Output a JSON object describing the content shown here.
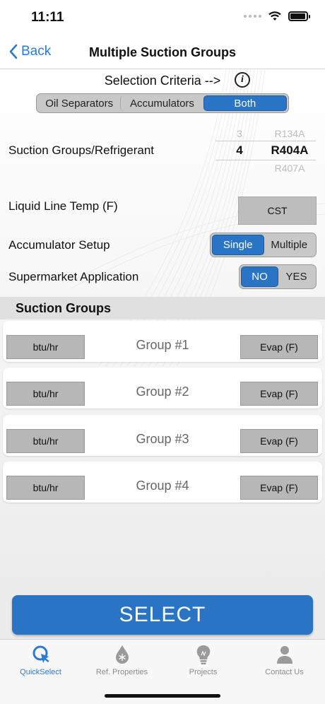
{
  "status": {
    "time": "11:11"
  },
  "nav": {
    "back_label": "Back",
    "title": "Multiple Suction Groups"
  },
  "criteria": {
    "label": "Selection Criteria -->",
    "options": [
      "Oil Separators",
      "Accumulators",
      "Both"
    ],
    "selected": "Both"
  },
  "suction": {
    "label": "Suction Groups/Refrigerant",
    "picker": {
      "prev": [
        "3",
        "R134A"
      ],
      "selected": [
        "4",
        "R404A"
      ],
      "next": [
        "",
        "R407A"
      ]
    }
  },
  "liquid_line": {
    "label": "Liquid Line Temp (F)",
    "button": "CST"
  },
  "accumulator": {
    "label": "Accumulator Setup",
    "options": [
      "Single",
      "Multiple"
    ],
    "selected": "Single"
  },
  "supermarket": {
    "label": "Supermarket Application",
    "options": [
      "NO",
      "YES"
    ],
    "selected": "NO"
  },
  "groups_section": {
    "title": "Suction Groups"
  },
  "groups": [
    {
      "name": "Group #1",
      "load": "btu/hr",
      "evap": "Evap (F)"
    },
    {
      "name": "Group #2",
      "load": "btu/hr",
      "evap": "Evap (F)"
    },
    {
      "name": "Group #3",
      "load": "btu/hr",
      "evap": "Evap (F)"
    },
    {
      "name": "Group #4",
      "load": "btu/hr",
      "evap": "Evap (F)"
    }
  ],
  "action": {
    "select_label": "SELECT"
  },
  "tabs": [
    {
      "label": "QuickSelect",
      "icon": "quickselect-icon",
      "active": true
    },
    {
      "label": "Ref. Properties",
      "icon": "snowflake-drop-icon",
      "active": false
    },
    {
      "label": "Projects",
      "icon": "lightbulb-icon",
      "active": false
    },
    {
      "label": "Contact Us",
      "icon": "person-icon",
      "active": false
    }
  ],
  "colors": {
    "accent": "#2a74c6",
    "link": "#2a7ad6",
    "button_gray": "#b7b7b7"
  }
}
